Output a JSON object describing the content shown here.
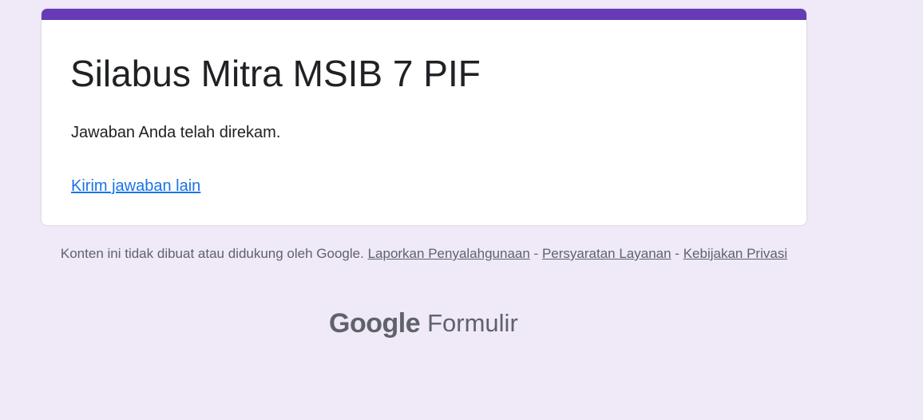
{
  "form": {
    "title": "Silabus Mitra MSIB 7 PIF",
    "confirmation_message": "Jawaban Anda telah direkam.",
    "another_response_link": "Kirim jawaban lain"
  },
  "footer": {
    "disclaimer": "Konten ini tidak dibuat atau didukung oleh Google.",
    "separator": "-",
    "report_abuse_link": "Laporkan Penyalahgunaan",
    "terms_link": "Persyaratan Layanan",
    "privacy_link": "Kebijakan Privasi"
  },
  "brand": {
    "google": "Google",
    "product": "Formulir"
  },
  "colors": {
    "background": "#efe9f8",
    "accent": "#673ab7",
    "link": "#1a73e8",
    "muted_text": "#5f6368"
  }
}
